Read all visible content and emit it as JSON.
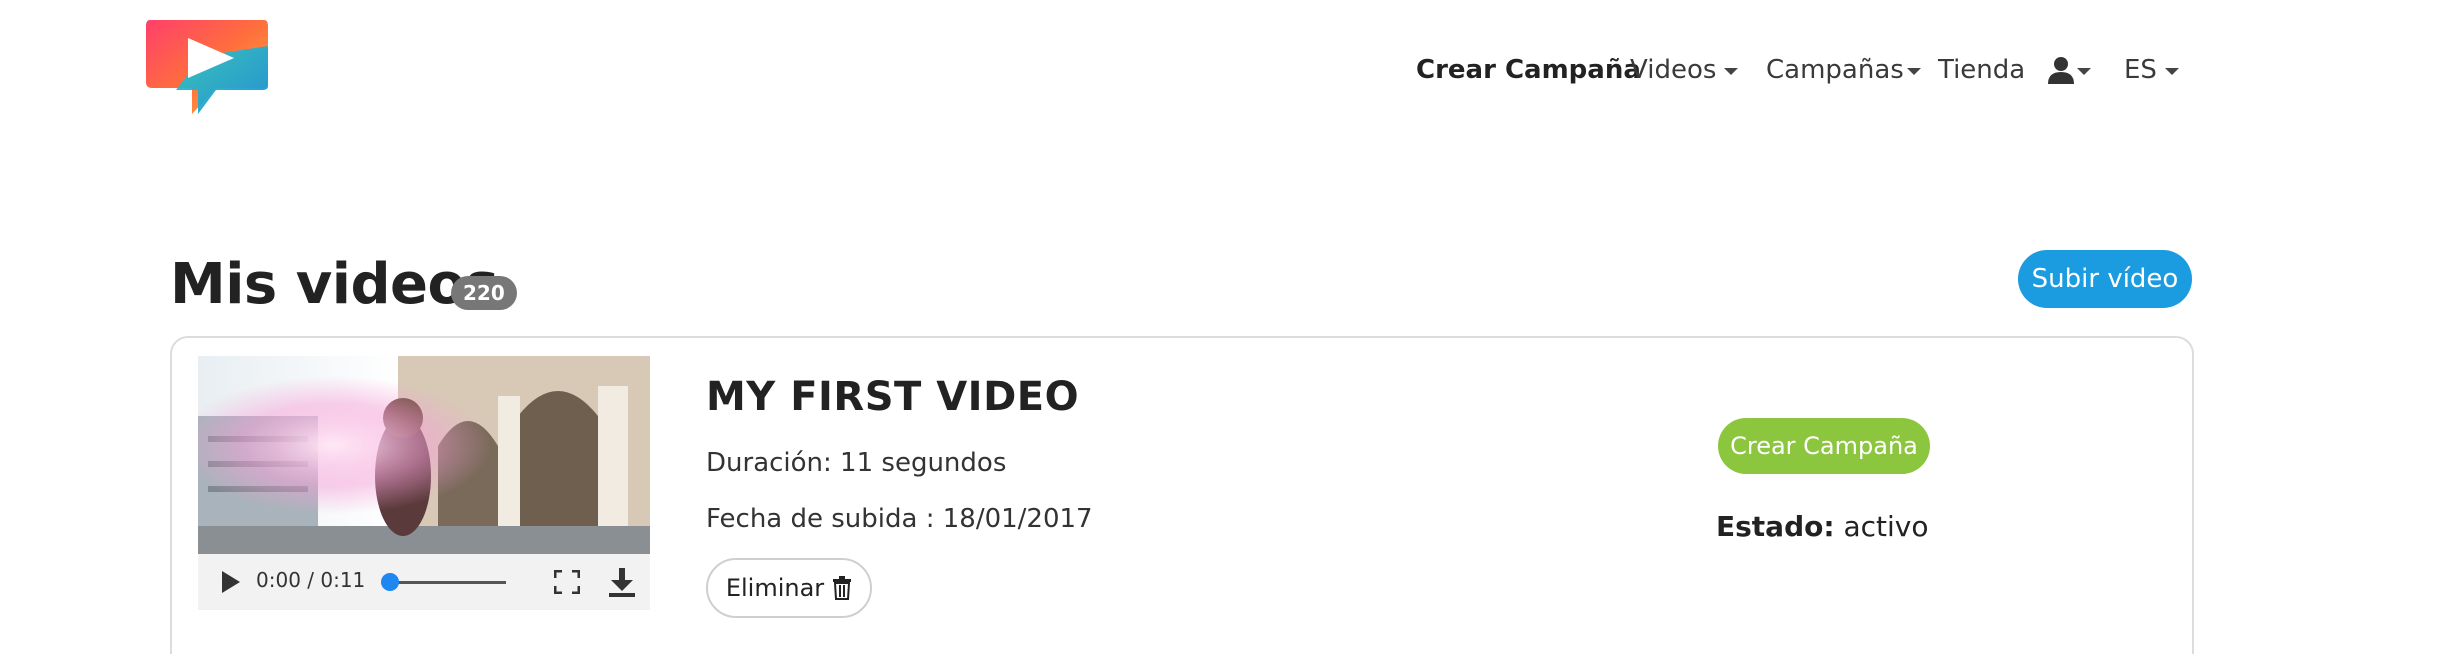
{
  "header": {
    "logo_icon": "play-bubble-logo-icon",
    "nav": {
      "create_campaign": "Crear Campaña",
      "videos": "Videos",
      "campaigns": "Campañas",
      "store": "Tienda",
      "user_icon": "user-icon",
      "language": "ES"
    }
  },
  "main": {
    "title": "Mis videos",
    "count": "220",
    "upload_button": "Subir vídeo"
  },
  "videos": [
    {
      "title": "MY FIRST VIDEO",
      "duration": "Duración: 11 segundos",
      "upload_date": "Fecha de subida : 18/01/2017",
      "delete_label": "Eliminar",
      "player_time": "0:00 / 0:11",
      "create_campaign": "Crear Campaña",
      "status_label": "Estado:",
      "status_value": "activo"
    }
  ],
  "colors": {
    "upload_button": "#1b9be0",
    "campaign_button": "#8cc63f",
    "badge": "#777777"
  }
}
